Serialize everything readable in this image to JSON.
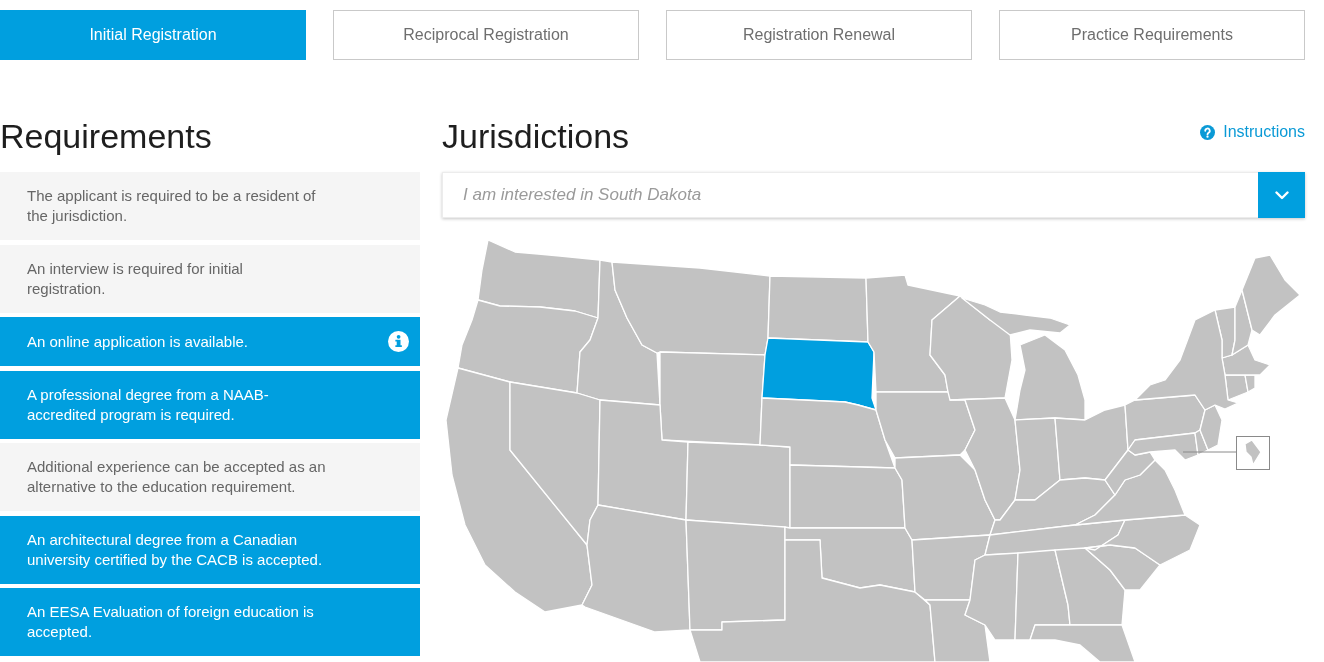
{
  "tabs": [
    {
      "label": "Initial Registration",
      "selected": true
    },
    {
      "label": "Reciprocal Registration",
      "selected": false
    },
    {
      "label": "Registration Renewal",
      "selected": false
    },
    {
      "label": "Practice Requirements",
      "selected": false
    }
  ],
  "requirements": {
    "title": "Requirements",
    "items": [
      {
        "text": "The applicant is required to be a resident of\nthe jurisdiction.",
        "highlighted": false,
        "info": false
      },
      {
        "text": "An interview is required for initial\nregistration.",
        "highlighted": false,
        "info": false
      },
      {
        "text": "An online application is available.",
        "highlighted": true,
        "info": true
      },
      {
        "text": "A professional degree from a NAAB-\naccredited program is required.",
        "highlighted": true,
        "info": false
      },
      {
        "text": "Additional experience can be accepted as an\nalternative to the education requirement.",
        "highlighted": false,
        "info": false
      },
      {
        "text": "An architectural degree from a Canadian\nuniversity certified by the CACB is accepted.",
        "highlighted": true,
        "info": false
      },
      {
        "text": "An EESA Evaluation of foreign education is\naccepted.",
        "highlighted": true,
        "info": false
      }
    ]
  },
  "jurisdictions": {
    "title": "Jurisdictions",
    "instructions_link": "Instructions",
    "dropdown": {
      "value": "I am interested in South Dakota"
    },
    "map": {
      "regions": [
        {
          "selected": false
        },
        {
          "selected": false
        },
        {
          "selected": false
        },
        {
          "selected": false
        },
        {
          "selected": false
        },
        {
          "selected": false
        },
        {
          "selected": false
        },
        {
          "selected": false
        },
        {
          "selected": false
        },
        {
          "selected": false
        },
        {
          "selected": false
        },
        {
          "selected": false
        },
        {
          "selected": true
        },
        {
          "selected": false
        },
        {
          "selected": false
        },
        {
          "selected": false
        },
        {
          "selected": false
        },
        {
          "selected": false
        },
        {
          "selected": false
        },
        {
          "selected": false
        },
        {
          "selected": false
        },
        {
          "selected": false
        },
        {
          "selected": false
        },
        {
          "selected": false
        },
        {
          "selected": false
        },
        {
          "selected": false
        },
        {
          "selected": false
        },
        {
          "selected": false
        },
        {
          "selected": false
        },
        {
          "selected": false
        },
        {
          "selected": false
        },
        {
          "selected": false
        },
        {
          "selected": false
        },
        {
          "selected": false
        },
        {
          "selected": false
        },
        {
          "selected": false
        },
        {
          "selected": false
        },
        {
          "selected": false
        },
        {
          "selected": false
        },
        {
          "selected": false
        },
        {
          "selected": false
        },
        {
          "selected": false
        },
        {
          "selected": false
        },
        {
          "selected": false
        },
        {
          "selected": false
        },
        {
          "selected": false
        },
        {
          "selected": false
        },
        {
          "selected": false
        },
        {
          "selected": false
        }
      ]
    }
  }
}
